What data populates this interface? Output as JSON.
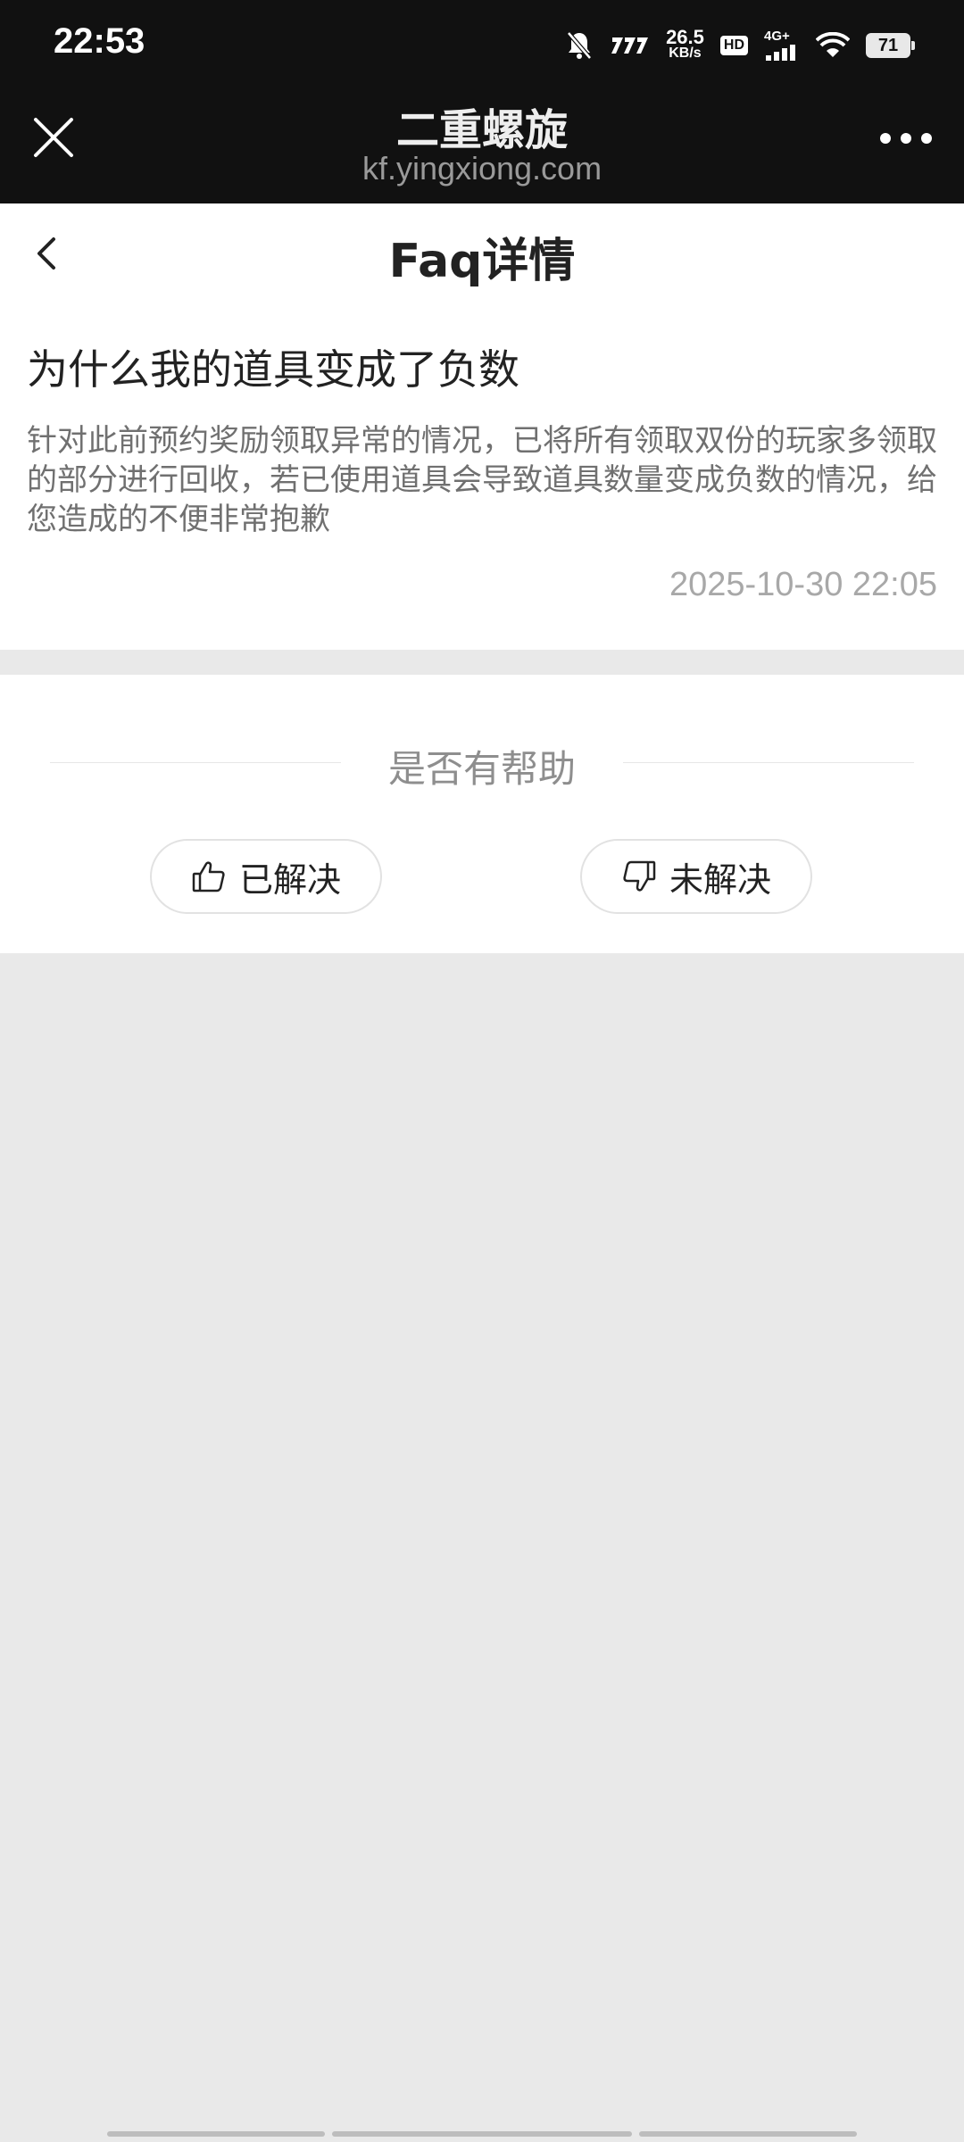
{
  "status_bar": {
    "time": "22:53",
    "net_speed_value": "26.5",
    "net_speed_unit": "KB/s",
    "hd_label": "HD",
    "signal_label": "4G+",
    "battery": "71",
    "icons": [
      "mute-icon",
      "carrier-icon",
      "signal-icon",
      "wifi-icon",
      "battery-icon"
    ]
  },
  "browser": {
    "title": "二重螺旋",
    "url": "kf.yingxiong.com",
    "close_icon": "close-icon",
    "more_icon": "more-icon"
  },
  "header": {
    "title": "Faq详情",
    "back_icon": "chevron-left-icon"
  },
  "faq": {
    "question": "为什么我的道具变成了负数",
    "answer": "针对此前预约奖励领取异常的情况，已将所有领取双份的玩家多领取的部分进行回收，若已使用道具会导致道具数量变成负数的情况，给您造成的不便非常抱歉",
    "date": "2025-10-30 22:05"
  },
  "feedback": {
    "title": "是否有帮助",
    "resolved_label": "已解决",
    "unresolved_label": "未解决",
    "resolved_icon": "thumbs-up-icon",
    "unresolved_icon": "thumbs-down-icon"
  },
  "colors": {
    "top_bar": "#111111",
    "page_bg": "#e9e9e9",
    "card_bg": "#ffffff",
    "muted_text": "#8e8e8e"
  }
}
